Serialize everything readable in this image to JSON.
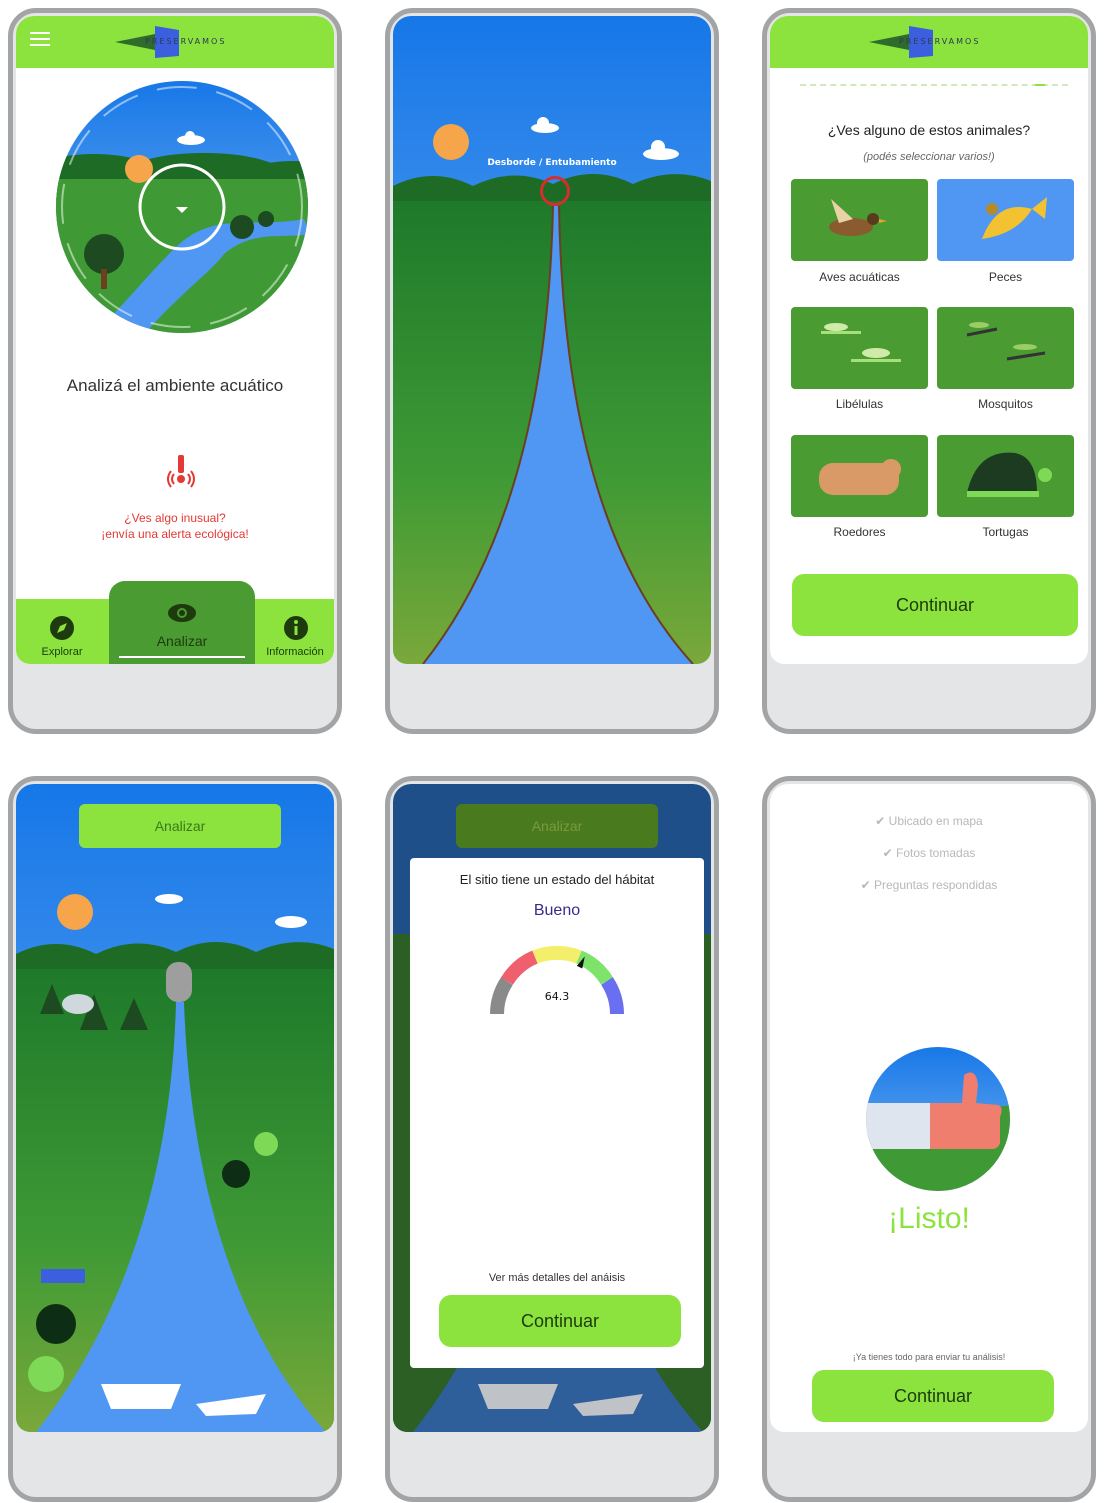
{
  "screen1": {
    "logo": "PRESERVAMOS",
    "title": "Analizá el ambiente acuático",
    "alert_line1": "¿Ves algo inusual?",
    "alert_line2": "¡envía una alerta ecológica!",
    "nav": [
      {
        "label": "Explorar",
        "icon": "compass-icon"
      },
      {
        "label": "Analizar",
        "icon": "eye-icon"
      },
      {
        "label": "Información",
        "icon": "info-icon"
      }
    ]
  },
  "screen2": {
    "marker_label": "Desborde / Entubamiento"
  },
  "screen3": {
    "logo": "PRESERVAMOS",
    "question": "¿Ves alguno de estos animales?",
    "hint": "(podés seleccionar varios!)",
    "animals": [
      {
        "label": "Aves acuáticas",
        "selected": false
      },
      {
        "label": "Peces",
        "selected": true
      },
      {
        "label": "Libélulas",
        "selected": false
      },
      {
        "label": "Mosquitos",
        "selected": false
      },
      {
        "label": "Roedores",
        "selected": false
      },
      {
        "label": "Tortugas",
        "selected": false
      }
    ],
    "continue": "Continuar"
  },
  "screen4": {
    "analyze_button": "Analizar"
  },
  "screen5": {
    "analyze_button": "Analizar",
    "habitat_text": "El sitio tiene un estado del hábitat",
    "status": "Bueno",
    "gauge_value": "64.3",
    "gauge_fraction": 0.643,
    "details_link": "Ver más detalles del anáisis",
    "continue": "Continuar"
  },
  "screen6": {
    "checks": [
      "Ubicado en mapa",
      "Fotos tomadas",
      "Preguntas respondidas"
    ],
    "ready": "¡Listo!",
    "message": "¡Ya tienes todo para enviar tu análisis!",
    "continue": "Continuar"
  },
  "colors": {
    "brand_green": "#8ce33e",
    "dark_green": "#3f9a35",
    "sky_blue": "#3f8ce0",
    "river_blue": "#4f97f3",
    "alert_red": "#e53935"
  }
}
